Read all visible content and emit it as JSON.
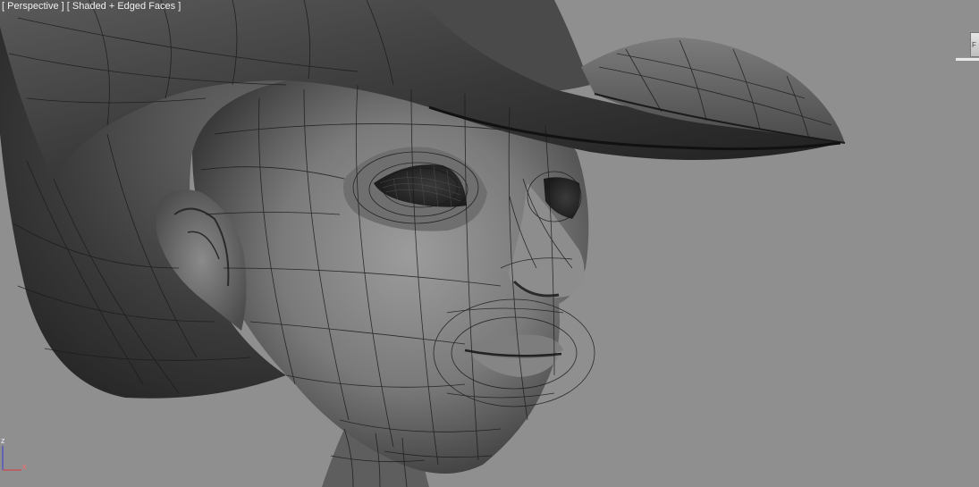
{
  "viewport": {
    "view_menu_label": "[ Perspective ]",
    "shading_menu_label": "[ Shaded + Edged Faces ]",
    "colors": {
      "background": "#8f8f8f",
      "mesh_shadow": "#2a2a2a",
      "mesh_mid": "#6e6e6e",
      "mesh_light": "#9a9a9a",
      "wire": "#1a1a1a",
      "label_text": "#f0f0f0"
    }
  },
  "viewcube": {
    "face_label": "F"
  },
  "axis_tripod": {
    "z_label": "z",
    "x_label": "x",
    "z_color": "#3a3ad8",
    "x_color": "#d83a3a"
  }
}
